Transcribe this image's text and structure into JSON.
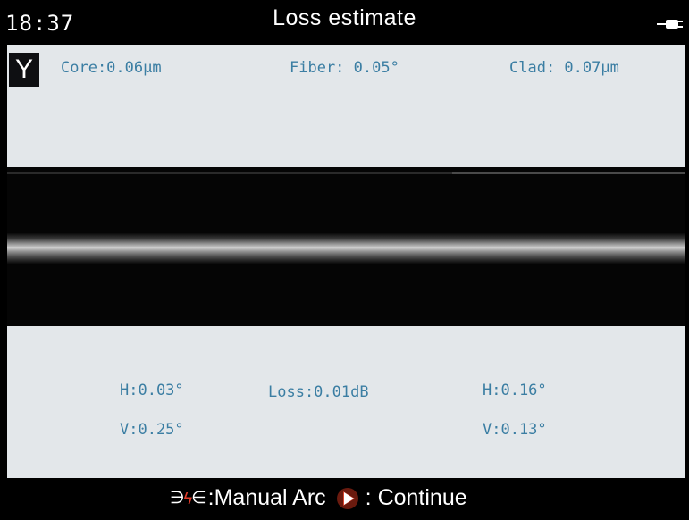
{
  "header": {
    "time": "18:37",
    "title": "Loss estimate"
  },
  "axis_indicator": "Y",
  "measurements_top": {
    "core": "Core:0.06μm",
    "fiber": "Fiber: 0.05°",
    "clad": "Clad: 0.07μm"
  },
  "measurements_bottom": {
    "left_h": "H:0.03°",
    "left_v": "V:0.25°",
    "loss": "Loss:0.01dB",
    "right_h": "H:0.16°",
    "right_v": "V:0.13°"
  },
  "footer": {
    "arc_icon_brackets": [
      "∋",
      "∈"
    ],
    "arc_icon_bolt": "ϟ",
    "manual_arc_label": ":Manual Arc",
    "continue_label": ": Continue"
  },
  "colors": {
    "panel_bg": "#e3e7ea",
    "stat_text": "#3b7ea3",
    "accent_red": "#e23b2a"
  },
  "icons": [
    "battery-plug-icon",
    "arc-icon",
    "play-icon"
  ]
}
